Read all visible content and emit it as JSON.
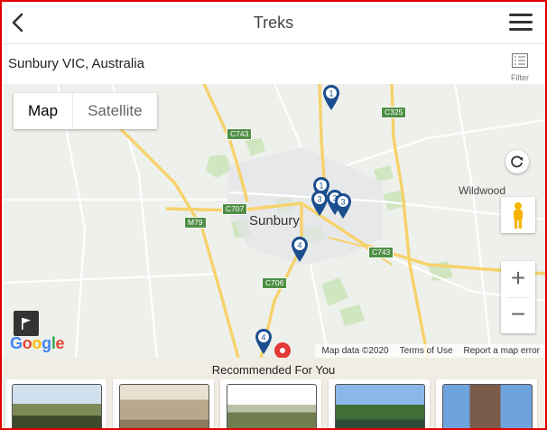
{
  "header": {
    "title": "Treks"
  },
  "location": {
    "text": "Sunbury VIC, Australia",
    "filter_label": "Filter"
  },
  "map": {
    "map_type": {
      "map_label": "Map",
      "satellite_label": "Satellite",
      "selected": "Map"
    },
    "places": {
      "sunbury": "Sunbury",
      "wildwood": "Wildwood"
    },
    "road_shields": [
      "C325",
      "C743",
      "C707",
      "M79",
      "C743",
      "C706"
    ],
    "markers": [
      "1",
      "1",
      "3",
      "3",
      "3",
      "4",
      "4"
    ],
    "logo_text": "Google",
    "attribution": {
      "map_data": "Map data ©2020",
      "terms": "Terms of Use",
      "report": "Report a map error"
    },
    "zoom_in": "+",
    "zoom_out": "−"
  },
  "recommended": {
    "title": "Recommended For You",
    "items": 5
  },
  "colors": {
    "frame_border": "#e00000",
    "marker": "#1a4e8f",
    "road_major": "#f6d26b",
    "park": "#cfe6c0",
    "recommended_bg": "#f2ede4"
  }
}
